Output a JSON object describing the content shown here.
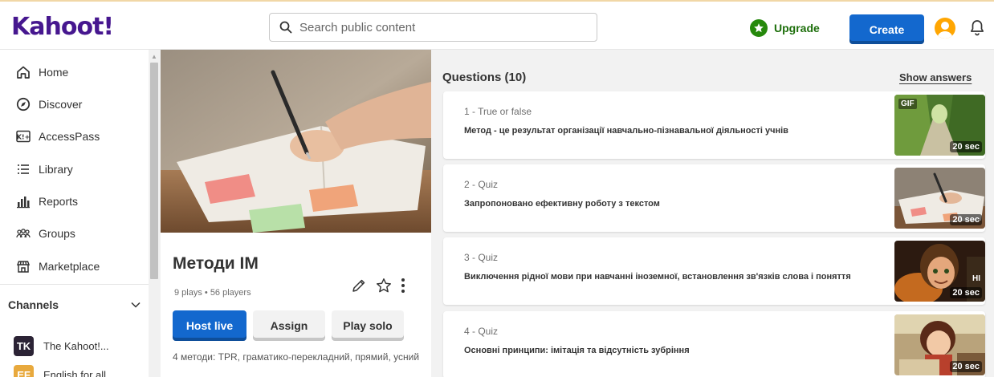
{
  "header": {
    "logo": "Kahoot!",
    "search_placeholder": "Search public content",
    "upgrade_label": "Upgrade",
    "create_label": "Create"
  },
  "sidebar": {
    "items": [
      {
        "label": "Home",
        "icon": "home-icon"
      },
      {
        "label": "Discover",
        "icon": "compass-icon"
      },
      {
        "label": "AccessPass",
        "icon": "accesspass-icon"
      },
      {
        "label": "Library",
        "icon": "list-icon"
      },
      {
        "label": "Reports",
        "icon": "bar-chart-icon"
      },
      {
        "label": "Groups",
        "icon": "groups-icon"
      },
      {
        "label": "Marketplace",
        "icon": "marketplace-icon"
      }
    ],
    "channels_label": "Channels",
    "channels": [
      {
        "badge": "TK",
        "name": "The Kahoot!...",
        "color": "#2b2335"
      },
      {
        "badge": "EF",
        "name": "English for all",
        "color": "#e8a93d"
      }
    ]
  },
  "kahoot": {
    "title": "Методи ІМ",
    "meta": "9 plays • 56 players",
    "host_label": "Host live",
    "assign_label": "Assign",
    "solo_label": "Play solo",
    "description": "4 методи: TPR, граматико-перекладний, прямий, усний"
  },
  "questions_header": "Questions (10)",
  "show_answers_label": "Show answers",
  "questions": [
    {
      "type": "1 - True or false",
      "text": "Метод - це результат організації навчально-пізнавальної діяльності учнів",
      "time": "20 sec",
      "gif": "GIF"
    },
    {
      "type": "2 - Quiz",
      "text": "Запропоновано ефективну роботу з текстом",
      "time": "20 sec"
    },
    {
      "type": "3 - Quiz",
      "text": "Виключення рідної мови при навчанні іноземної, встановлення зв'язків слова і поняття",
      "time": "20 sec",
      "overlay": "HI"
    },
    {
      "type": "4 - Quiz",
      "text": "Основні принципи: імітація та відсутність зубріння",
      "time": "20 sec"
    }
  ],
  "colors": {
    "brand": "#46178f",
    "primary_button": "#1368ce",
    "upgrade_green": "#26890c",
    "avatar": "#ffa602"
  }
}
